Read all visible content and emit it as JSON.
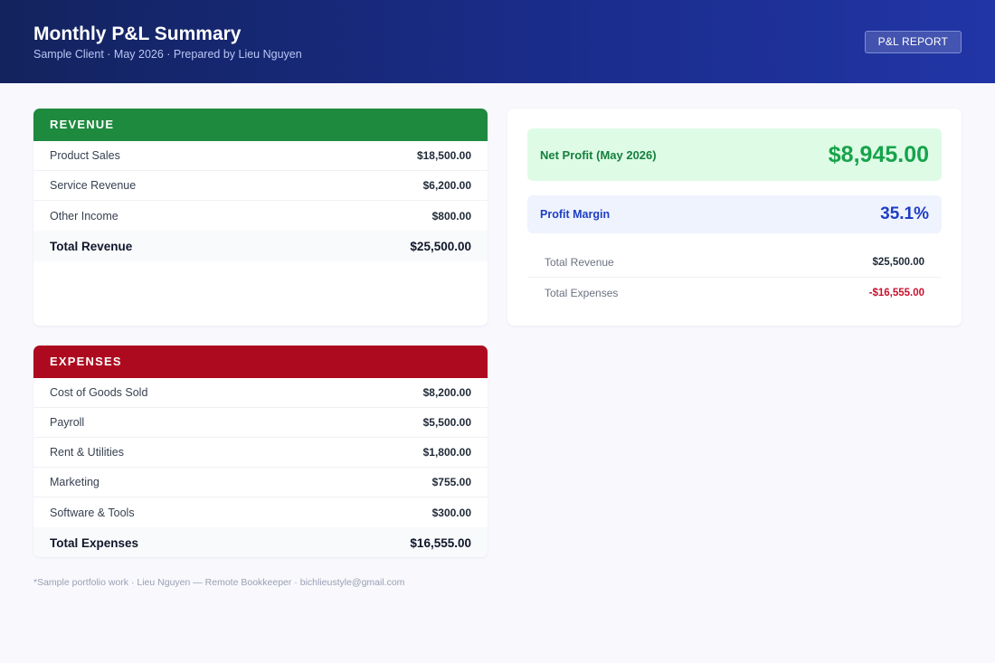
{
  "header": {
    "title": "Monthly P&L Summary",
    "subtitle": "Sample Client · May 2026 · Prepared by Lieu Nguyen",
    "badge": "P&L REPORT"
  },
  "revenue": {
    "heading": "REVENUE",
    "color": "#1e8a3e",
    "items": [
      {
        "label": "Product Sales",
        "amount": "$18,500.00"
      },
      {
        "label": "Service Revenue",
        "amount": "$6,200.00"
      },
      {
        "label": "Other Income",
        "amount": "$800.00"
      }
    ],
    "total_label": "Total Revenue",
    "total_amount": "$25,500.00"
  },
  "expenses": {
    "heading": "EXPENSES",
    "color": "#ad0a1f",
    "items": [
      {
        "label": "Cost of Goods Sold",
        "amount": "$8,200.00"
      },
      {
        "label": "Payroll",
        "amount": "$5,500.00"
      },
      {
        "label": "Rent & Utilities",
        "amount": "$1,800.00"
      },
      {
        "label": "Marketing",
        "amount": "$755.00"
      },
      {
        "label": "Software & Tools",
        "amount": "$300.00"
      }
    ],
    "total_label": "Total Expenses",
    "total_amount": "$16,555.00"
  },
  "summary": {
    "net_profit_label": "Net Profit (May 2026)",
    "net_profit_value": "$8,945.00",
    "margin_label": "Profit Margin",
    "margin_value": "35.1%",
    "rows": [
      {
        "label": "Total Revenue",
        "amount": "$25,500.00"
      },
      {
        "label": "Total Expenses",
        "amount": "-$16,555.00"
      }
    ]
  },
  "footer": {
    "text": "*Sample portfolio work · Lieu Nguyen — Remote Bookkeeper · bichlieustyle@gmail.com"
  }
}
